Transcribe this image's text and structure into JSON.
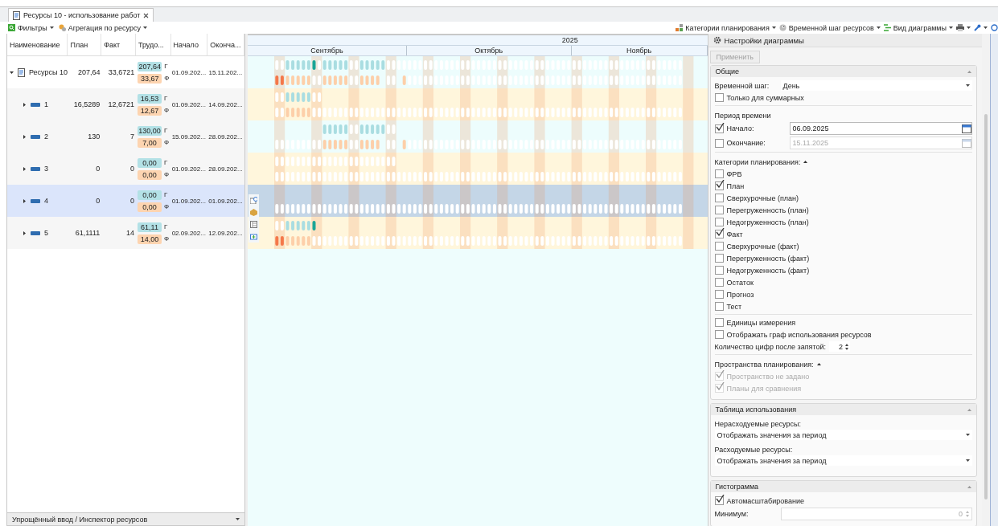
{
  "tab": {
    "title": "Ресурсы 10 - использование работ",
    "selected": true
  },
  "toolbar_left": [
    {
      "label": "Фильтры"
    },
    {
      "label": "Агрегация по ресурсу"
    }
  ],
  "toolbar_right": [
    {
      "label": "Категории планирования"
    },
    {
      "label": "Временной шаг ресурсов"
    },
    {
      "label": "Вид диаграммы"
    }
  ],
  "table": {
    "columns": [
      "Наименование",
      "План",
      "Факт",
      "Трудо...",
      "Начало",
      "Оконча..."
    ],
    "rows": [
      {
        "kind": "root",
        "name": "Ресурсы 10",
        "expanded": true,
        "selected": false,
        "plan": "207,64",
        "fact": "33,6721",
        "work_plan": "207,64",
        "work_plan_mark": "Г",
        "work_fact": "33,67",
        "work_fact_mark": "Ф",
        "start": "01.09.202...",
        "end": "15.11.202..."
      },
      {
        "kind": "resource",
        "name": "1",
        "expanded": false,
        "selected": false,
        "plan": "16,5289",
        "fact": "12,6721",
        "work_plan": "16,53",
        "work_plan_mark": "Г",
        "work_fact": "12,67",
        "work_fact_mark": "Ф",
        "start": "01.09.202...",
        "end": "14.09.202..."
      },
      {
        "kind": "resource",
        "name": "2",
        "expanded": false,
        "selected": false,
        "plan": "130",
        "fact": "7",
        "work_plan": "130,00",
        "work_plan_mark": "Г",
        "work_fact": "7,00",
        "work_fact_mark": "Ф",
        "start": "15.09.202...",
        "end": "28.09.202..."
      },
      {
        "kind": "resource",
        "name": "3",
        "expanded": false,
        "selected": false,
        "plan": "0",
        "fact": "0",
        "work_plan": "0,00",
        "work_plan_mark": "Г",
        "work_fact": "0,00",
        "work_fact_mark": "Ф",
        "start": "01.09.202...",
        "end": "28.09.202..."
      },
      {
        "kind": "resource",
        "name": "4",
        "expanded": false,
        "selected": true,
        "plan": "0",
        "fact": "0",
        "work_plan": "0,00",
        "work_plan_mark": "Г",
        "work_fact": "0,00",
        "work_fact_mark": "Ф",
        "start": "01.09.202...",
        "end": "01.09.202..."
      },
      {
        "kind": "resource",
        "name": "5",
        "expanded": false,
        "selected": false,
        "plan": "61,1111",
        "fact": "14",
        "work_plan": "61,11",
        "work_plan_mark": "Г",
        "work_fact": "14,00",
        "work_fact_mark": "Ф",
        "start": "02.09.202...",
        "end": "12.09.202..."
      }
    ]
  },
  "bottom_panel": {
    "title": "Упрощённый ввод / Инспектор ресурсов"
  },
  "chart": {
    "year": "2025",
    "months": [
      "Сентябрь",
      "Октябрь",
      "Ноябрь"
    ]
  },
  "settings": {
    "title": "Настройки диаграммы",
    "apply": {
      "label": "Применить",
      "disabled": true
    },
    "sections": [
      {
        "title": "Общие",
        "items": [
          {
            "kind": "select",
            "label": "Временной шаг:",
            "value": "День"
          },
          {
            "kind": "checkbox",
            "label": "Только для суммарных",
            "checked": false,
            "disabled": false
          },
          {
            "kind": "divider"
          },
          {
            "kind": "heading",
            "label": "Период времени",
            "collapsible": false
          },
          {
            "kind": "date",
            "label": "Начало:",
            "checked": true,
            "value": "06.09.2025"
          },
          {
            "kind": "date",
            "label": "Окончание:",
            "checked": false,
            "value": "15.11.2025"
          },
          {
            "kind": "divider"
          },
          {
            "kind": "heading",
            "label": "Категории планирования:",
            "collapsible": true
          },
          {
            "kind": "checkbox",
            "label": "ФРВ",
            "checked": false,
            "disabled": false
          },
          {
            "kind": "checkbox",
            "label": "План",
            "checked": true,
            "disabled": false
          },
          {
            "kind": "checkbox",
            "label": "Сверхурочные (план)",
            "checked": false,
            "disabled": false
          },
          {
            "kind": "checkbox",
            "label": "Перегруженность (план)",
            "checked": false,
            "disabled": false
          },
          {
            "kind": "checkbox",
            "label": "Недогруженность (план)",
            "checked": false,
            "disabled": false
          },
          {
            "kind": "checkbox",
            "label": "Факт",
            "checked": true,
            "disabled": false
          },
          {
            "kind": "checkbox",
            "label": "Сверхурочные (факт)",
            "checked": false,
            "disabled": false
          },
          {
            "kind": "checkbox",
            "label": "Перегруженность (факт)",
            "checked": false,
            "disabled": false
          },
          {
            "kind": "checkbox",
            "label": "Недогруженность (факт)",
            "checked": false,
            "disabled": false
          },
          {
            "kind": "checkbox",
            "label": "Остаток",
            "checked": false,
            "disabled": false
          },
          {
            "kind": "checkbox",
            "label": "Прогноз",
            "checked": false,
            "disabled": false
          },
          {
            "kind": "checkbox",
            "label": "Тест",
            "checked": false,
            "disabled": false
          },
          {
            "kind": "divider"
          },
          {
            "kind": "checkbox",
            "label": "Единицы измерения",
            "checked": false,
            "disabled": false
          },
          {
            "kind": "checkbox",
            "label": "Отображать граф использования ресурсов",
            "checked": false,
            "disabled": false
          },
          {
            "kind": "spin",
            "label": "Количество цифр после запятой:",
            "value": "2"
          },
          {
            "kind": "divider"
          },
          {
            "kind": "heading",
            "label": "Пространства планирования:",
            "collapsible": true
          },
          {
            "kind": "checkbox",
            "label": "Пространство не задано",
            "checked": true,
            "disabled": true
          },
          {
            "kind": "checkbox",
            "label": "Планы для сравнения",
            "checked": true,
            "disabled": true
          }
        ]
      },
      {
        "title": "Таблица использования",
        "items": [
          {
            "kind": "caption",
            "label": "Нерасходуемые ресурсы:"
          },
          {
            "kind": "combo",
            "value": "Отображать значения за период"
          },
          {
            "kind": "caption",
            "label": "Расходуемые ресурсы:"
          },
          {
            "kind": "combo",
            "value": "Отображать значения за период"
          }
        ]
      },
      {
        "title": "Гистограмма",
        "items": [
          {
            "kind": "checkbox",
            "label": "Автомасштабирование",
            "checked": true,
            "disabled": false
          },
          {
            "kind": "number",
            "label": "Минимум:",
            "value": "0",
            "disabled": true
          }
        ]
      }
    ]
  }
}
